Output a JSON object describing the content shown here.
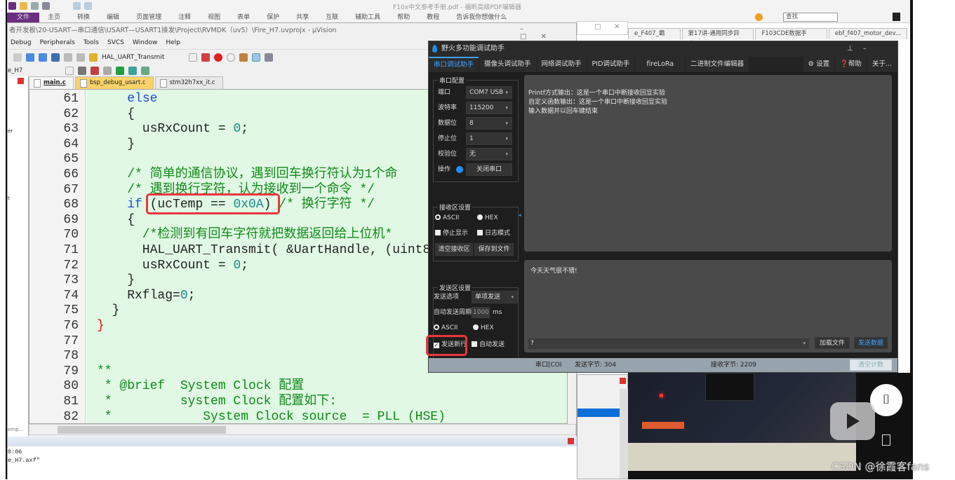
{
  "pdf_editor": {
    "title": "F10x中文参考手册.pdf - 福昕高级PDF编辑器",
    "menu": [
      "文件",
      "主页",
      "转换",
      "编辑",
      "页面管理",
      "注释",
      "视图",
      "表单",
      "保护",
      "共享",
      "互联",
      "辅助工具",
      "帮助",
      "教程",
      "告诉我你想做什么"
    ],
    "search_placeholder": "查找",
    "tabs": [
      "e_F407_霸天...",
      "第17讲-通用同步异步...",
      "F103CDE数据手册.pdf",
      "ebf_f407_motor_dev..."
    ]
  },
  "keil": {
    "title": "者开发板\\20-USART—串口通信\\USART—USART1接发\\Project\\RVMDK（uv5）\\Fire_H7.uvprojx - µVision",
    "menu": [
      "Debug",
      "Peripherals",
      "Tools",
      "SVCS",
      "Window",
      "Help"
    ],
    "find_value": "HAL_UART_Transmit",
    "target": "e_H7",
    "file_tabs": [
      "main.c",
      "bsp_debug_usart.c",
      "stm32h7xx_it.c"
    ],
    "proj_panel_text": [
      "er",
      "t",
      "emp..."
    ],
    "code": [
      {
        "n": "61",
        "s": [
          [
            "    ",
            "tx"
          ],
          [
            "else",
            "kw"
          ]
        ]
      },
      {
        "n": "62",
        "s": [
          [
            "    {",
            "tx"
          ]
        ]
      },
      {
        "n": "63",
        "s": [
          [
            "      usRxCount = ",
            "tx"
          ],
          [
            "0",
            "num"
          ],
          [
            ";",
            "tx"
          ]
        ]
      },
      {
        "n": "64",
        "s": [
          [
            "    }",
            "tx"
          ]
        ]
      },
      {
        "n": "65",
        "s": [
          [
            "",
            "tx"
          ]
        ]
      },
      {
        "n": "66",
        "s": [
          [
            "    /* 简单的通信协议，遇到回车换行符认为1个命",
            "cm"
          ]
        ]
      },
      {
        "n": "67",
        "s": [
          [
            "    /* 遇到换行字符，认为接收到一个命令 */",
            "cm"
          ]
        ]
      },
      {
        "n": "68",
        "s": [
          [
            "    ",
            "tx"
          ],
          [
            "if",
            "kw"
          ],
          [
            " (ucTemp == ",
            "tx"
          ],
          [
            "0x0A",
            "num"
          ],
          [
            ") ",
            "tx"
          ],
          [
            "/* 换行字符 */",
            "cm"
          ]
        ]
      },
      {
        "n": "69",
        "s": [
          [
            "    {",
            "tx"
          ]
        ]
      },
      {
        "n": "70",
        "s": [
          [
            "      /*检测到有回车字符就把数据返回给上位机*",
            "cm"
          ]
        ]
      },
      {
        "n": "71",
        "s": [
          [
            "      HAL_UART_Transmit( &UartHandle, (uint8_",
            "tx"
          ]
        ]
      },
      {
        "n": "72",
        "s": [
          [
            "      usRxCount = ",
            "tx"
          ],
          [
            "0",
            "num"
          ],
          [
            ";",
            "tx"
          ]
        ]
      },
      {
        "n": "73",
        "s": [
          [
            "    }",
            "tx"
          ]
        ]
      },
      {
        "n": "74",
        "s": [
          [
            "    Rxflag=",
            "tx"
          ],
          [
            "0",
            "num"
          ],
          [
            ";",
            "tx"
          ]
        ]
      },
      {
        "n": "75",
        "s": [
          [
            "  }",
            "tx"
          ]
        ]
      },
      {
        "n": "76",
        "s": [
          [
            "}",
            "red"
          ]
        ]
      },
      {
        "n": "77",
        "s": [
          [
            "",
            "tx"
          ]
        ]
      },
      {
        "n": "78",
        "s": [
          [
            "",
            "tx"
          ]
        ]
      },
      {
        "n": "79",
        "s": [
          [
            "**",
            "cm"
          ]
        ]
      },
      {
        "n": "80",
        "s": [
          [
            " * @brief  System Clock 配置",
            "cm"
          ]
        ]
      },
      {
        "n": "81",
        "s": [
          [
            " *         system Clock 配置如下:",
            "cm"
          ]
        ]
      },
      {
        "n": "82",
        "s": [
          [
            " *            System Clock source  = PLL (HSE)",
            "cm"
          ]
        ]
      }
    ],
    "output_lines": [
      "0:06",
      "e_H7.axf\""
    ]
  },
  "fire": {
    "title": "野火多功能调试助手",
    "tabs": [
      "串口调试助手",
      "摄像头调试助手",
      "网络调试助手",
      "PID调试助手",
      "fireLoRa",
      "二进制文件编辑器"
    ],
    "settings": "设置",
    "help": "帮助",
    "about": "关于...",
    "serial_cfg": {
      "title": "串口配置",
      "port_label": "端口",
      "port": "COM7 USB",
      "baud_label": "波特率",
      "baud": "115200",
      "data_label": "数据位",
      "data": "8",
      "stop_label": "停止位",
      "stop": "1",
      "parity_label": "校验位",
      "parity": "无",
      "op_label": "操作",
      "op_button": "关闭串口",
      "status_color": "#1e90ff"
    },
    "recv_cfg": {
      "title": "接收区设置",
      "ascii": "ASCII",
      "hex": "HEX",
      "stop_display": "停止显示",
      "log_mode": "日志模式",
      "clear": "清空接收区",
      "save": "保存到文件"
    },
    "send_cfg": {
      "title": "发送区设置",
      "opt_label": "发送选项",
      "opt": "单项发送",
      "period_label": "自动发送周期",
      "period": "1000",
      "unit": "ms",
      "ascii": "ASCII",
      "hex": "HEX",
      "newline": "发送新行",
      "newline_checked": true,
      "auto_send": "自动发送"
    },
    "recv_text": [
      "Printf方式输出：这是一个串口中断接收回显实验",
      "自定义函数输出：这是一个串口中断接收回显实验",
      "输入数据并以回车键结束"
    ],
    "send_text": "今天天气很不错!",
    "history_value": "?",
    "load_file": "加载文件",
    "send": "发送数据",
    "status": {
      "port": "串口[COI",
      "sent": "发送字节: 304",
      "recv": "接收字节: 2209",
      "clear": "清空计数"
    }
  },
  "watermark": "CSDN @徐霞客fans",
  "colors": {
    "highlight": "#e8373b",
    "accent": "#3ba3ff",
    "code_bg": "#e0f8e4"
  }
}
